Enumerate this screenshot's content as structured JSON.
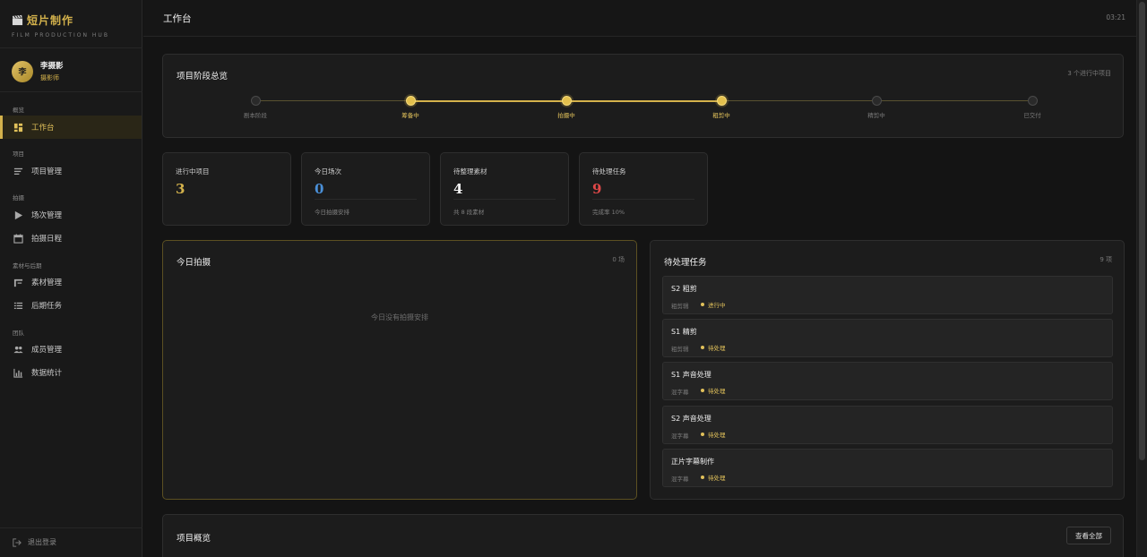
{
  "brand": {
    "title": "短片制作",
    "subtitle": "FILM PRODUCTION HUB",
    "icon": "clapperboard-icon"
  },
  "user": {
    "avatar_char": "李",
    "name": "李摄影",
    "role": "摄影师"
  },
  "nav": {
    "groups": [
      "概览",
      "项目",
      "拍摄",
      "素材与后期",
      "团队"
    ],
    "items": [
      {
        "label": "工作台",
        "icon": "dashboard-icon",
        "active": true
      },
      {
        "label": "项目管理",
        "icon": "list-icon"
      },
      {
        "label": "场次管理",
        "icon": "play-icon"
      },
      {
        "label": "拍摄日程",
        "icon": "calendar-icon"
      },
      {
        "label": "素材管理",
        "icon": "film-icon"
      },
      {
        "label": "后期任务",
        "icon": "tasks-icon"
      },
      {
        "label": "成员管理",
        "icon": "users-icon"
      },
      {
        "label": "数据统计",
        "icon": "chart-icon"
      }
    ],
    "logout": "退出登录"
  },
  "header": {
    "title": "工作台",
    "time": "03:21"
  },
  "stages": {
    "title": "项目阶段总览",
    "meta": "3 个进行中项目",
    "items": [
      {
        "label": "剧本阶段",
        "active": false
      },
      {
        "label": "筹备中",
        "active": true
      },
      {
        "label": "拍摄中",
        "active": true
      },
      {
        "label": "粗剪中",
        "active": true
      },
      {
        "label": "精剪中",
        "active": false
      },
      {
        "label": "已交付",
        "active": false
      }
    ]
  },
  "stats": [
    {
      "label": "进行中项目",
      "value": "3",
      "sub": "",
      "color": "#d4b24c"
    },
    {
      "label": "今日场次",
      "value": "0",
      "sub": "今日拍摄安排",
      "color": "#4a90d9"
    },
    {
      "label": "待整理素材",
      "value": "4",
      "sub": "共 8 段素材",
      "color": "#f2f2f2"
    },
    {
      "label": "待处理任务",
      "value": "9",
      "sub": "完成率 10%",
      "color": "#e04848"
    }
  ],
  "today_shoot": {
    "title": "今日拍摄",
    "meta": "0 场",
    "empty": "今日没有拍摄安排"
  },
  "pending_tasks": {
    "title": "待处理任务",
    "meta": "9 项",
    "items": [
      {
        "title": "S2 粗剪",
        "type": "粗剪辑",
        "status": "进行中"
      },
      {
        "title": "S1 精剪",
        "type": "粗剪辑",
        "status": "待处理"
      },
      {
        "title": "S1 声音处理",
        "type": "混字幕",
        "status": "待处理"
      },
      {
        "title": "S2 声音处理",
        "type": "混字幕",
        "status": "待处理"
      },
      {
        "title": "正片字幕制作",
        "type": "混字幕",
        "status": "待处理"
      }
    ]
  },
  "overview": {
    "title": "项目概览",
    "view_all": "查看全部"
  },
  "colors": {
    "accent": "#d4b24c",
    "background": "#141414",
    "card": "#1c1c1c"
  }
}
